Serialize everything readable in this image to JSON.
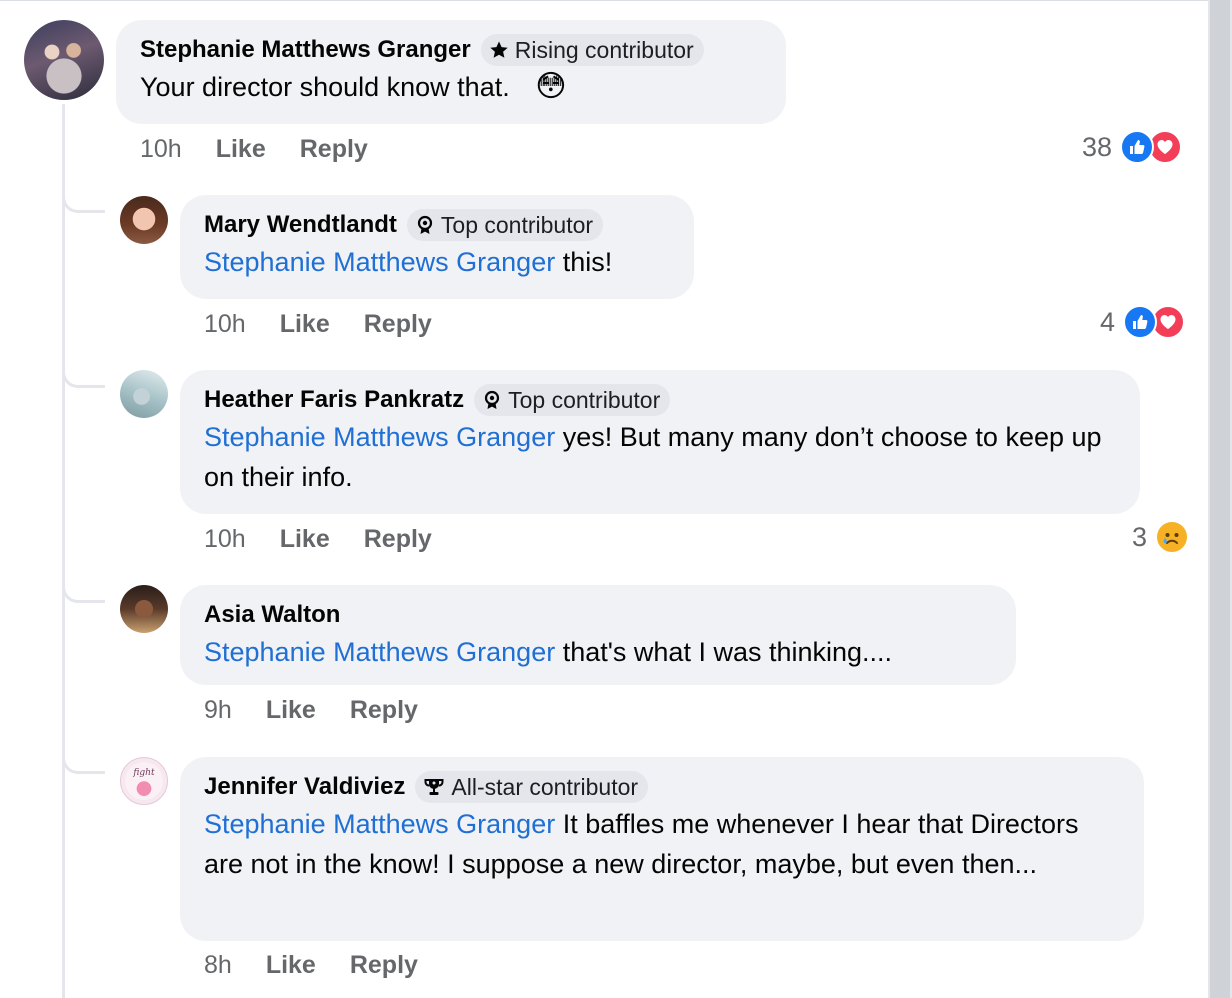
{
  "comments": [
    {
      "author": "Stephanie Matthews Granger",
      "badge": "Rising contributor",
      "badge_icon": "star-icon",
      "mention": "",
      "text": "Your director should know that.",
      "emoji": "😳",
      "time": "10h",
      "like_label": "Like",
      "reply_label": "Reply",
      "reaction_count": "38",
      "reactions": [
        "like",
        "love"
      ]
    },
    {
      "author": "Mary Wendtlandt",
      "badge": "Top contributor",
      "badge_icon": "contributor-medal-icon",
      "mention": "Stephanie Matthews Granger",
      "text": "this!",
      "time": "10h",
      "like_label": "Like",
      "reply_label": "Reply",
      "reaction_count": "4",
      "reactions": [
        "like",
        "love"
      ]
    },
    {
      "author": "Heather Faris Pankratz",
      "badge": "Top contributor",
      "badge_icon": "contributor-medal-icon",
      "mention": "Stephanie Matthews Granger",
      "text": "yes!  But many many don’t choose to keep up on their info.",
      "time": "10h",
      "like_label": "Like",
      "reply_label": "Reply",
      "reaction_count": "3",
      "reactions": [
        "sad"
      ]
    },
    {
      "author": "Asia Walton",
      "badge": "",
      "mention": "Stephanie Matthews Granger",
      "text": "that's what I was thinking....",
      "time": "9h",
      "like_label": "Like",
      "reply_label": "Reply"
    },
    {
      "author": "Jennifer Valdiviez",
      "badge": "All-star contributor",
      "badge_icon": "trophy-icon",
      "mention": "Stephanie Matthews Granger",
      "text": "It baffles me whenever I hear that Directors are not in the know! I suppose a new director, maybe, but even then...",
      "time": "8h",
      "like_label": "Like",
      "reply_label": "Reply",
      "avatar_text": "fight"
    }
  ],
  "colors": {
    "bubble": "#f0f2f5",
    "mention": "#1f6fd4",
    "meta": "#65676b",
    "like_reaction": "#1877f2",
    "love_reaction": "#f33e58",
    "sad_reaction": "#f7b125"
  }
}
